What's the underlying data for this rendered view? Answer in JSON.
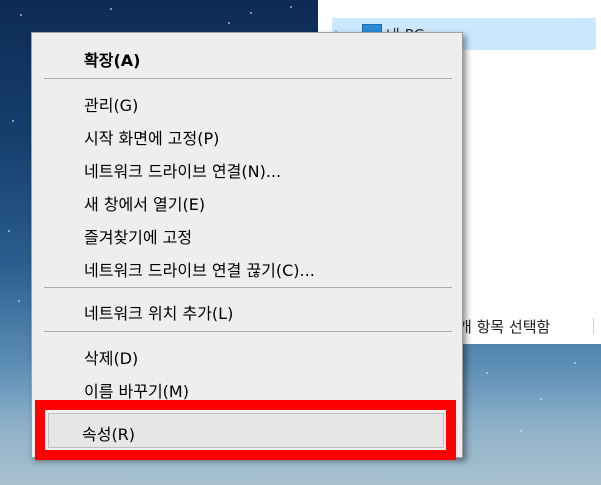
{
  "explorer": {
    "tree_item_label": "내 PC",
    "status_text": "개 항목 선택함"
  },
  "context_menu": {
    "items": [
      {
        "label": "확장(A)",
        "bold": true
      },
      {
        "label": "관리(G)"
      },
      {
        "label": "시작 화면에 고정(P)"
      },
      {
        "label": "네트워크 드라이브 연결(N)..."
      },
      {
        "label": "새 창에서 열기(E)"
      },
      {
        "label": "즐겨찾기에 고정"
      },
      {
        "label": "네트워크 드라이브 연결 끊기(C)..."
      },
      {
        "label": "네트워크 위치 추가(L)"
      },
      {
        "label": "삭제(D)"
      },
      {
        "label": "이름 바꾸기(M)"
      },
      {
        "label": "속성(R)"
      }
    ]
  },
  "highlight_color": "#ff0000"
}
